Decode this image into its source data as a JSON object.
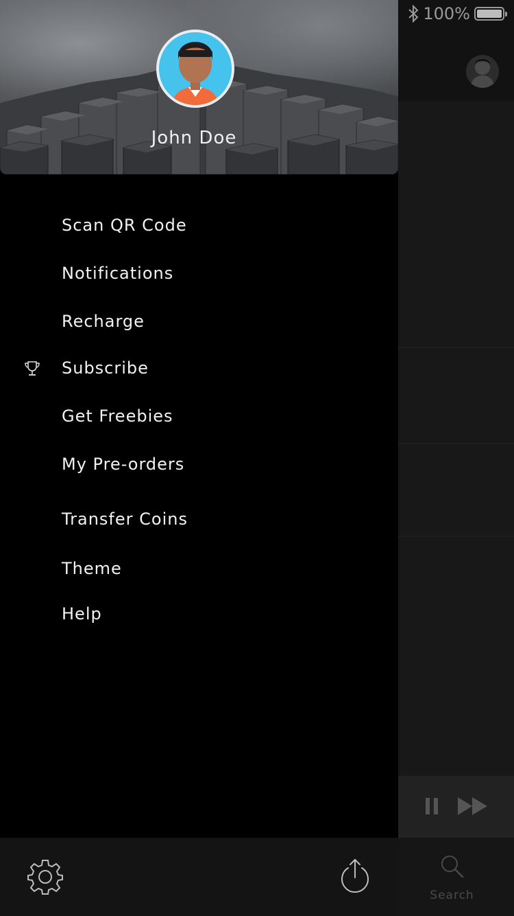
{
  "status_bar": {
    "bluetooth_icon": "bluetooth-icon",
    "battery_text": "100%",
    "battery_icon": "battery-icon"
  },
  "profile": {
    "name": "John Doe",
    "avatar_icon": "user-avatar-icon"
  },
  "menu": {
    "items": [
      {
        "label": "Scan QR Code",
        "icon": null
      },
      {
        "label": "Notifications",
        "icon": null
      },
      {
        "label": "Recharge",
        "icon": null
      },
      {
        "label": "Subscribe",
        "icon": "trophy-icon"
      },
      {
        "label": "Get Freebies",
        "icon": null
      },
      {
        "label": "My Pre-orders",
        "icon": null
      },
      {
        "label": "Transfer Coins",
        "icon": null
      },
      {
        "label": "Theme",
        "icon": null
      },
      {
        "label": "Help",
        "icon": null
      }
    ]
  },
  "footer": {
    "settings_icon": "gear-icon",
    "logout_icon": "power-icon"
  },
  "background_app": {
    "player": {
      "pause_icon": "pause-icon",
      "next_icon": "fast-forward-icon"
    },
    "bottom_nav": {
      "search_label": "Search",
      "search_icon": "search-icon"
    }
  },
  "colors": {
    "drawer_bg": "#000000",
    "avatar_bg": "#46c3ec",
    "avatar_shirt": "#f26b3a",
    "text": "#f2f2f2"
  }
}
